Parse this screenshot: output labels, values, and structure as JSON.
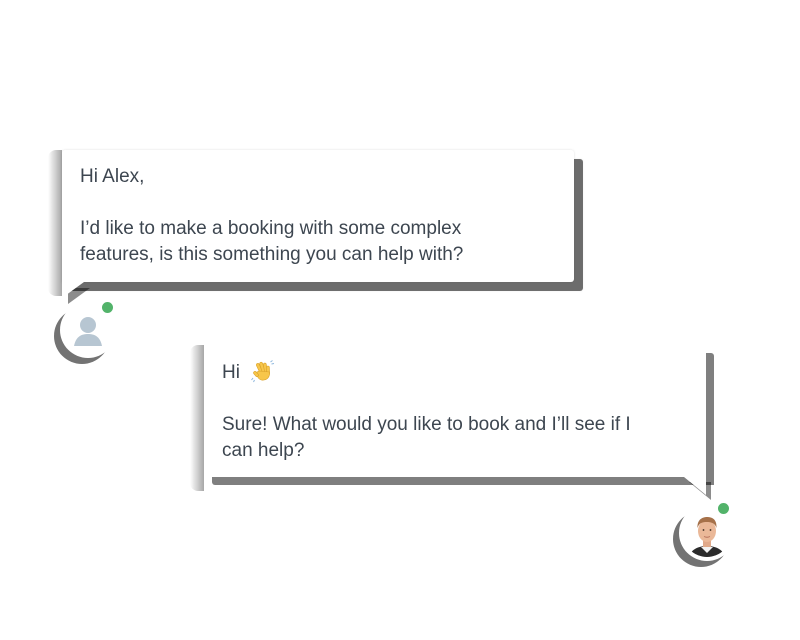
{
  "conversation": {
    "user_message": {
      "greeting": "Hi Alex,",
      "body_line_1": "I’d like to make a booking with some complex",
      "body_line_2": "features, is this something you can help with?"
    },
    "agent_message": {
      "greeting": "Hi",
      "greeting_emoji": "waving-hand-emoji",
      "body_line_1": "Sure! What would you like to book and I’ll see if I",
      "body_line_2": "can help?"
    },
    "user_avatar": {
      "icon": "generic-person-icon",
      "status": "online"
    },
    "agent_avatar": {
      "icon": "agent-photo",
      "status": "online"
    }
  },
  "colors": {
    "text": "#3d4650",
    "online": "#52b36a",
    "avatar_placeholder": "#b7c6d2"
  }
}
